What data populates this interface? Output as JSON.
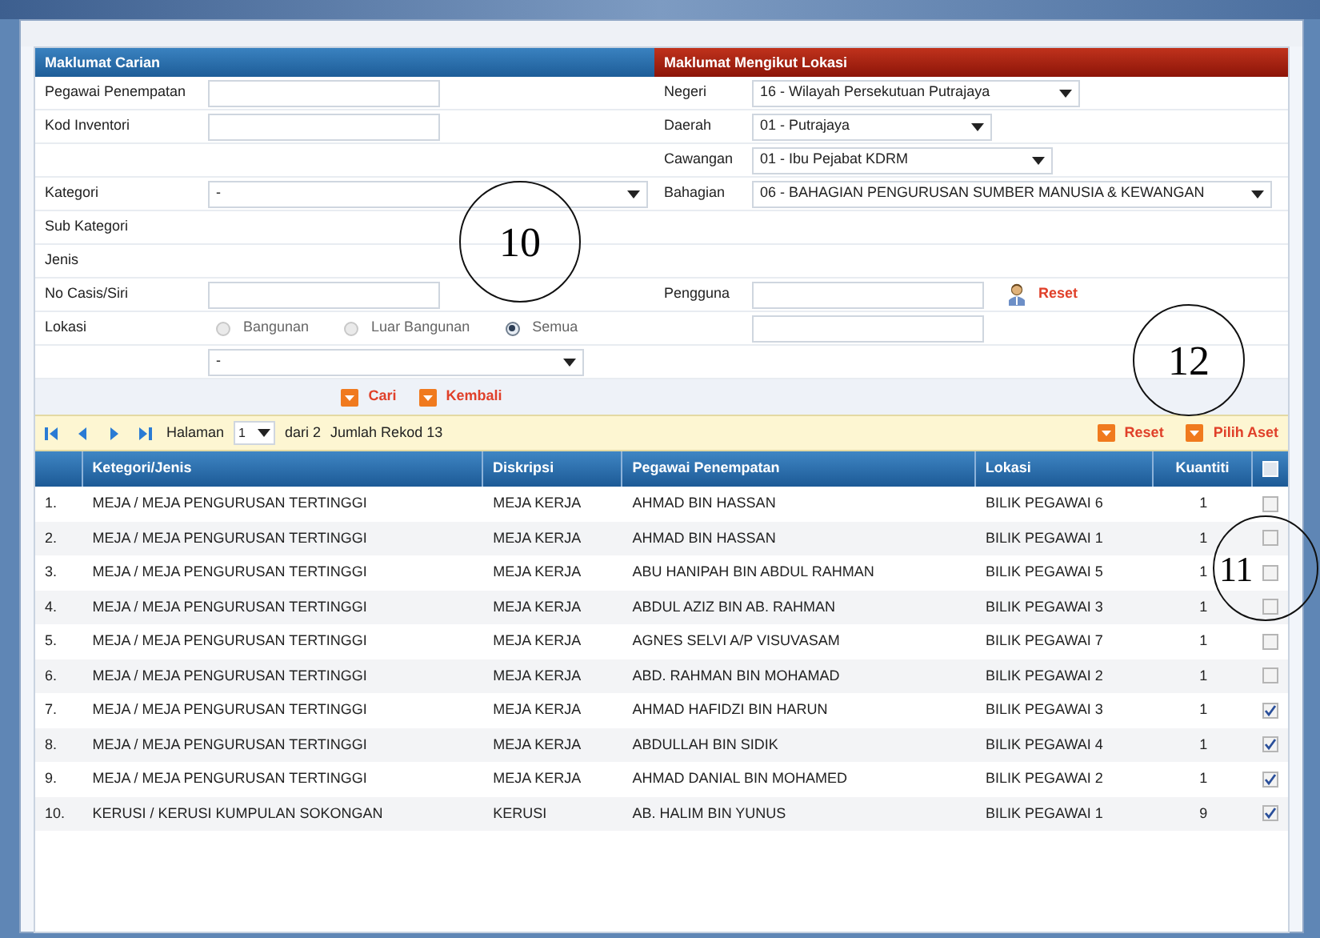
{
  "search_form": {
    "left_title": "Maklumat Carian",
    "right_title": "Maklumat Mengikut Lokasi",
    "left_fields": [
      {
        "kind": "input",
        "label": "Pegawai Penempatan"
      },
      {
        "kind": "input",
        "label": "Kod Inventori"
      },
      {
        "kind": "blank"
      },
      {
        "kind": "select",
        "label": "Kategori",
        "value": "-"
      },
      {
        "kind": "label",
        "label": "Sub Kategori"
      },
      {
        "kind": "label",
        "label": "Jenis"
      },
      {
        "kind": "input",
        "label": "No Casis/Siri"
      },
      {
        "kind": "radios",
        "label": "Lokasi",
        "options": [
          {
            "label": "Bangunan",
            "selected": false
          },
          {
            "label": "Luar Bangunan",
            "selected": false
          },
          {
            "label": "Semua",
            "selected": true
          }
        ]
      },
      {
        "kind": "select",
        "value": "-"
      }
    ],
    "right_fields": [
      {
        "kind": "select",
        "label": "Negeri",
        "value": "16 - Wilayah Persekutuan Putrajaya"
      },
      {
        "kind": "select",
        "label": "Daerah",
        "value": "01 - Putrajaya"
      },
      {
        "kind": "select",
        "label": "Cawangan",
        "value": "01 - Ibu Pejabat KDRM"
      },
      {
        "kind": "select",
        "label": "Bahagian",
        "value": "06 - BAHAGIAN PENGURUSAN SUMBER MANUSIA & KEWANGAN"
      },
      {
        "kind": "blank"
      },
      {
        "kind": "blank"
      },
      {
        "kind": "user_input",
        "label": "Pengguna",
        "action": "Reset"
      },
      {
        "kind": "input"
      },
      {
        "kind": "blank"
      }
    ],
    "buttons": [
      "Cari",
      "Kembali"
    ]
  },
  "pager": {
    "page_label": "Halaman",
    "page": "1",
    "of": "dari 2",
    "total": "Jumlah Rekod 13",
    "actions": [
      "Reset",
      "Pilih Aset"
    ]
  },
  "table": {
    "columns": [
      "Ketegori/Jenis",
      "Diskripsi",
      "Pegawai Penempatan",
      "Lokasi",
      "Kuantiti"
    ],
    "select_all_checked": false,
    "rows": [
      {
        "no": "1.",
        "kategori": "MEJA / MEJA PENGURUSAN TERTINGGI",
        "diskripsi": "MEJA KERJA",
        "pegawai": "AHMAD BIN HASSAN",
        "lokasi": "BILIK PEGAWAI 6",
        "kuantiti": "1",
        "checked": false
      },
      {
        "no": "2.",
        "kategori": "MEJA / MEJA PENGURUSAN TERTINGGI",
        "diskripsi": "MEJA KERJA",
        "pegawai": "AHMAD BIN HASSAN",
        "lokasi": "BILIK PEGAWAI 1",
        "kuantiti": "1",
        "checked": false
      },
      {
        "no": "3.",
        "kategori": "MEJA / MEJA PENGURUSAN TERTINGGI",
        "diskripsi": "MEJA KERJA",
        "pegawai": "ABU HANIPAH BIN ABDUL RAHMAN",
        "lokasi": "BILIK PEGAWAI 5",
        "kuantiti": "1",
        "checked": false
      },
      {
        "no": "4.",
        "kategori": "MEJA / MEJA PENGURUSAN TERTINGGI",
        "diskripsi": "MEJA KERJA",
        "pegawai": "ABDUL AZIZ BIN AB. RAHMAN",
        "lokasi": "BILIK PEGAWAI 3",
        "kuantiti": "1",
        "checked": false
      },
      {
        "no": "5.",
        "kategori": "MEJA / MEJA PENGURUSAN TERTINGGI",
        "diskripsi": "MEJA KERJA",
        "pegawai": "AGNES SELVI A/P VISUVASAM",
        "lokasi": "BILIK PEGAWAI 7",
        "kuantiti": "1",
        "checked": false
      },
      {
        "no": "6.",
        "kategori": "MEJA / MEJA PENGURUSAN TERTINGGI",
        "diskripsi": "MEJA KERJA",
        "pegawai": "ABD. RAHMAN BIN MOHAMAD",
        "lokasi": "BILIK PEGAWAI 2",
        "kuantiti": "1",
        "checked": false
      },
      {
        "no": "7.",
        "kategori": "MEJA / MEJA PENGURUSAN TERTINGGI",
        "diskripsi": "MEJA KERJA",
        "pegawai": "AHMAD HAFIDZI BIN HARUN",
        "lokasi": "BILIK PEGAWAI 3",
        "kuantiti": "1",
        "checked": true
      },
      {
        "no": "8.",
        "kategori": "MEJA / MEJA PENGURUSAN TERTINGGI",
        "diskripsi": "MEJA KERJA",
        "pegawai": "ABDULLAH BIN SIDIK",
        "lokasi": "BILIK PEGAWAI 4",
        "kuantiti": "1",
        "checked": true
      },
      {
        "no": "9.",
        "kategori": "MEJA / MEJA PENGURUSAN TERTINGGI",
        "diskripsi": "MEJA KERJA",
        "pegawai": "AHMAD DANIAL BIN MOHAMED",
        "lokasi": "BILIK PEGAWAI 2",
        "kuantiti": "1",
        "checked": true
      },
      {
        "no": "10.",
        "kategori": "KERUSI / KERUSI KUMPULAN SOKONGAN",
        "diskripsi": "KERUSI",
        "pegawai": "AB. HALIM BIN YUNUS",
        "lokasi": "BILIK PEGAWAI 1",
        "kuantiti": "9",
        "checked": true
      }
    ]
  },
  "callouts": [
    "10",
    "12",
    "11"
  ]
}
